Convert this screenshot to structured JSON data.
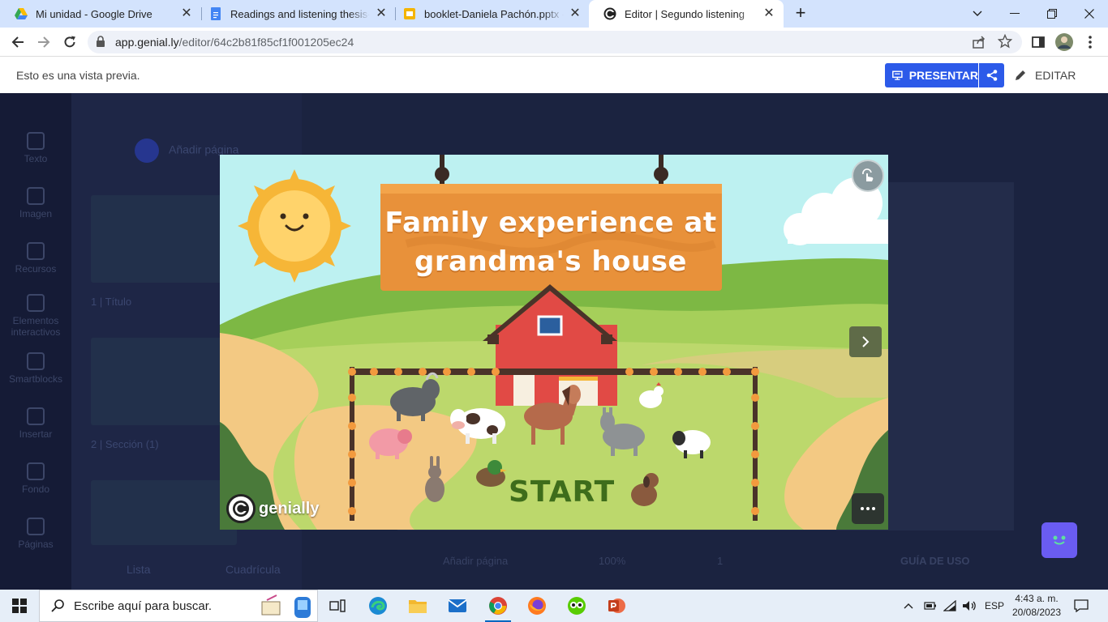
{
  "browser": {
    "tabs": [
      {
        "title": "Mi unidad - Google Drive",
        "icon": "google-drive-icon",
        "active": false
      },
      {
        "title": "Readings and listening thesis- bo",
        "icon": "google-docs-icon",
        "active": false
      },
      {
        "title": "booklet-Daniela Pachón.pptx - Pr",
        "icon": "google-slides-icon",
        "active": false
      },
      {
        "title": "Editor | Segundo listening",
        "icon": "genially-icon",
        "active": true
      }
    ],
    "new_tab_label": "+",
    "url_host": "app.genial.ly",
    "url_path": "/editor/64c2b81f85cf1f001205ec24"
  },
  "preview_bar": {
    "message": "Esto es una vista previa.",
    "present_label": "PRESENTAR",
    "edit_label": "EDITAR"
  },
  "editor_bg": {
    "sidebar": [
      "Texto",
      "Imagen",
      "Recursos",
      "Elementos interactivos",
      "Smartblocks",
      "Insertar",
      "Fondo",
      "Páginas"
    ],
    "add_page": "Añadir página",
    "pages": [
      "1 | Título",
      "2 | Sección (1)"
    ],
    "view_list": "Lista",
    "view_grid": "Cuadrícula",
    "bottom_add_page": "Añadir página",
    "zoom": "100%",
    "page_number": "1",
    "guide": "GUÍA DE USO"
  },
  "slide": {
    "title_line1": "Family experience at",
    "title_line2": "grandma's house",
    "start_label": "START",
    "brand_name": "genially"
  },
  "taskbar": {
    "search_placeholder": "Escribe aquí para buscar.",
    "language": "ESP",
    "time": "4:43 a. m.",
    "date": "20/08/2023"
  },
  "colors": {
    "accent_blue": "#2c5ae9",
    "sign_orange": "#e8913a",
    "barn_red": "#e14a45",
    "grass_green": "#b9d66a",
    "start_green": "#3e6d1b"
  }
}
